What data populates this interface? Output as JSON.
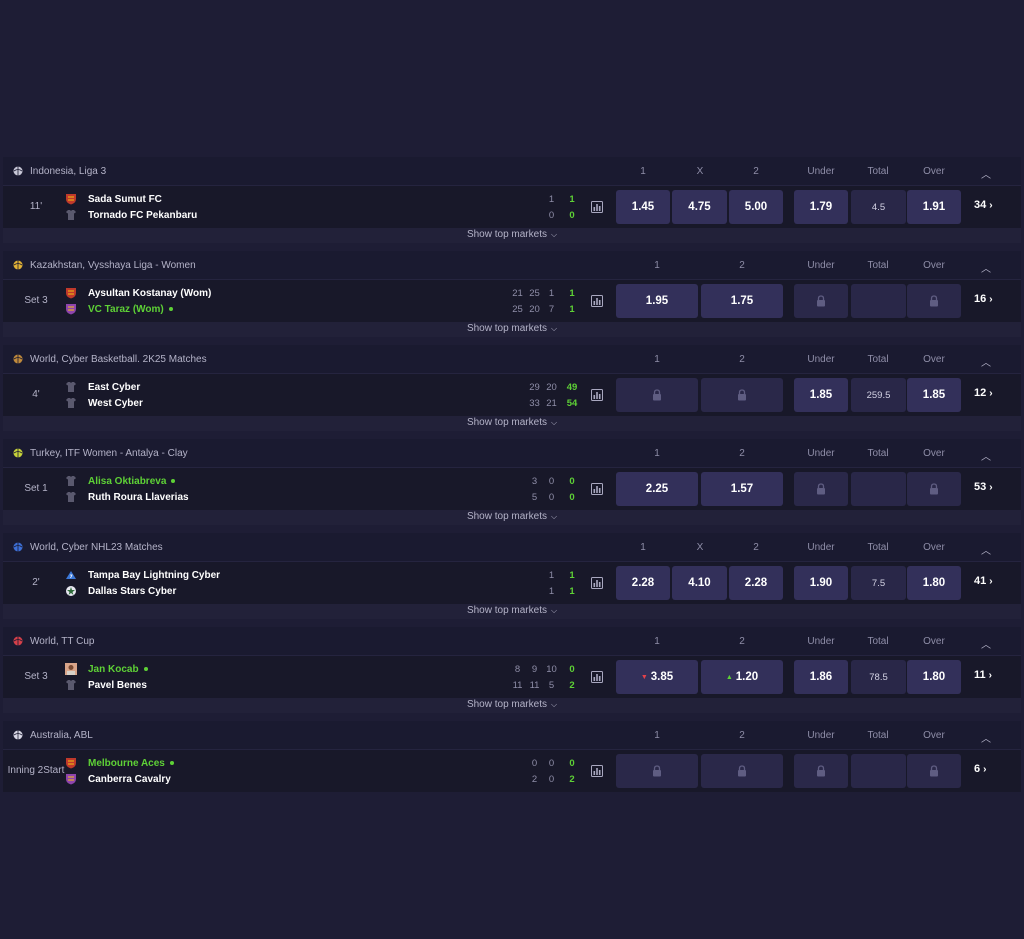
{
  "ui": {
    "show_top_markets": "Show top markets",
    "colors": {
      "bg": "#1e1d35",
      "odds_bg": "#33305a",
      "locked_bg": "#2a2849",
      "accent_green": "#5ed136",
      "down_red": "#e5414a"
    }
  },
  "events": [
    {
      "league": "Indonesia, Liga 3",
      "sport_icon": "soccer-ball-icon",
      "columns": [
        "1",
        "X",
        "2",
        "Under",
        "Total",
        "Over"
      ],
      "status_line1": "11'",
      "status_line2": "",
      "team1": "Sada Sumut FC",
      "team2": "Tornado FC Pekanbaru",
      "team1_logo": "team-crest-icon",
      "team2_logo": "team-shirt-icon",
      "team1_scores": [
        "1"
      ],
      "team1_total": "1",
      "team2_scores": [
        "0"
      ],
      "team2_total": "0",
      "odds1": "1.45",
      "oddsX": "4.75",
      "odds2": "5.00",
      "under": "1.79",
      "total": "4.5",
      "over": "1.91",
      "more_count": "34"
    },
    {
      "league": "Kazakhstan, Vysshaya Liga - Women",
      "sport_icon": "volleyball-icon",
      "columns": [
        "1",
        "2",
        "Under",
        "Total",
        "Over"
      ],
      "status_line1": "Set 3",
      "status_line2": "",
      "team1": "Aysultan Kostanay (Wom)",
      "team2": "VC Taraz (Wom)",
      "team1_logo": "team-crest-icon",
      "team2_logo": "team-crest-icon",
      "team2_serving": true,
      "team1_scores": [
        "21",
        "25",
        "1"
      ],
      "team1_total": "1",
      "team2_scores": [
        "25",
        "20",
        "7"
      ],
      "team2_total": "1",
      "odds1": "1.95",
      "odds2": "1.75",
      "total_locked": true,
      "more_count": "16"
    },
    {
      "league": "World, Cyber Basketball. 2K25 Matches",
      "sport_icon": "basketball-icon",
      "columns": [
        "1",
        "2",
        "Under",
        "Total",
        "Over"
      ],
      "status_line1": "4'",
      "status_line2": "",
      "team1": "East Cyber",
      "team2": "West Cyber",
      "team1_logo": "team-shirt-icon",
      "team2_logo": "team-shirt-icon",
      "team1_scores": [
        "29",
        "20"
      ],
      "team1_total": "49",
      "team2_scores": [
        "33",
        "21"
      ],
      "team2_total": "54",
      "main_locked": true,
      "under": "1.85",
      "total": "259.5",
      "over": "1.85",
      "more_count": "12"
    },
    {
      "league": "Turkey, ITF Women - Antalya - Clay",
      "sport_icon": "tennis-ball-icon",
      "columns": [
        "1",
        "2",
        "Under",
        "Total",
        "Over"
      ],
      "status_line1": "Set 1",
      "status_line2": "",
      "team1": "Alisa Oktiabreva",
      "team2": "Ruth Roura Llaverias",
      "team1_logo": "player-shirt-icon",
      "team2_logo": "player-shirt-icon",
      "team1_serving": true,
      "team1_scores": [
        "3",
        "0"
      ],
      "team1_total": "0",
      "team2_scores": [
        "5",
        "0"
      ],
      "team2_total": "0",
      "odds1": "2.25",
      "odds2": "1.57",
      "total_locked": true,
      "more_count": "53"
    },
    {
      "league": "World, Cyber NHL23 Matches",
      "sport_icon": "hockey-puck-icon",
      "columns": [
        "1",
        "X",
        "2",
        "Under",
        "Total",
        "Over"
      ],
      "status_line1": "2'",
      "status_line2": "",
      "team1": "Tampa Bay Lightning Cyber",
      "team2": "Dallas Stars Cyber",
      "team1_logo": "lightning-logo-icon",
      "team2_logo": "star-logo-icon",
      "team1_scores": [
        "1"
      ],
      "team1_total": "1",
      "team2_scores": [
        "1"
      ],
      "team2_total": "1",
      "odds1": "2.28",
      "oddsX": "4.10",
      "odds2": "2.28",
      "under": "1.90",
      "total": "7.5",
      "over": "1.80",
      "more_count": "41"
    },
    {
      "league": "World, TT Cup",
      "sport_icon": "table-tennis-icon",
      "columns": [
        "1",
        "2",
        "Under",
        "Total",
        "Over"
      ],
      "status_line1": "Set 3",
      "status_line2": "",
      "team1": "Jan Kocab",
      "team2": "Pavel Benes",
      "team1_logo": "player-photo-icon",
      "team2_logo": "player-shirt-icon",
      "team1_serving": true,
      "team1_scores": [
        "8",
        "9",
        "10"
      ],
      "team1_total": "0",
      "team2_scores": [
        "11",
        "11",
        "5"
      ],
      "team2_total": "2",
      "odds1": "3.85",
      "odds1_trend": "down",
      "odds2": "1.20",
      "odds2_trend": "up",
      "under": "1.86",
      "total": "78.5",
      "over": "1.80",
      "more_count": "11"
    },
    {
      "league": "Australia, ABL",
      "sport_icon": "baseball-icon",
      "columns": [
        "1",
        "2",
        "Under",
        "Total",
        "Over"
      ],
      "status_line1": "Inning 2",
      "status_line2": "Start",
      "team1": "Melbourne Aces",
      "team2": "Canberra Cavalry",
      "team1_logo": "team-crest-icon",
      "team2_logo": "team-crest-icon",
      "team1_serving": true,
      "team1_scores": [
        "0",
        "0"
      ],
      "team1_total": "0",
      "team2_scores": [
        "2",
        "0"
      ],
      "team2_total": "2",
      "main_locked": true,
      "total_locked": true,
      "more_count": "6",
      "no_footer": true
    }
  ]
}
